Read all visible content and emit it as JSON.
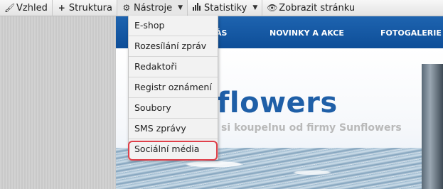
{
  "toolbar": {
    "items": [
      {
        "label": "Vzhled",
        "icon": "brush-icon"
      },
      {
        "label": "Struktura",
        "icon": "plus-icon"
      },
      {
        "label": "Nástroje",
        "icon": "gears-icon"
      },
      {
        "label": "Statistiky",
        "icon": "bar-chart-icon"
      },
      {
        "label": "Zobrazit stránku",
        "icon": "eye-icon"
      }
    ]
  },
  "site": {
    "nav": [
      "ÁS",
      "NOVINKY A AKCE",
      "FOTOGALERIE"
    ],
    "logo": "flowers",
    "tagline": "si koupelnu od firmy Sunflowers"
  },
  "dropdown": {
    "items": [
      "E-shop",
      "Rozesílání zpráv",
      "Redaktoři",
      "Registr oznámení",
      "Soubory",
      "SMS zprávy",
      "Sociální média"
    ],
    "highlighted_index": 6,
    "highlight_color": "#e0404a"
  },
  "colors": {
    "nav_blue": "#1e64b0",
    "logo_blue": "#1f5fa7"
  }
}
